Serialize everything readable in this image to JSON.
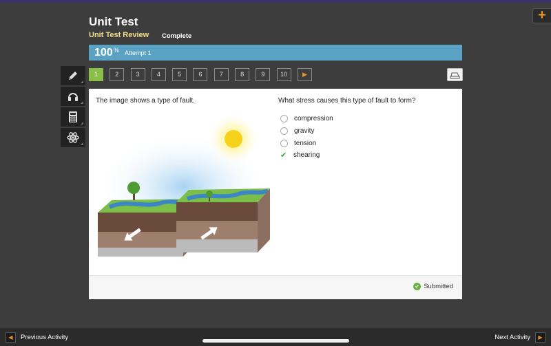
{
  "header": {
    "title": "Unit Test",
    "subtitle": "Unit Test Review",
    "status": "Complete",
    "plus_icon": "+"
  },
  "score": {
    "value": "100",
    "percent_symbol": "%",
    "attempt": "Attempt 1"
  },
  "tools": [
    {
      "icon": "pencil-icon"
    },
    {
      "icon": "headphones-icon"
    },
    {
      "icon": "calculator-icon"
    },
    {
      "icon": "atom-icon"
    }
  ],
  "question_nav": {
    "items": [
      "1",
      "2",
      "3",
      "4",
      "5",
      "6",
      "7",
      "8",
      "9",
      "10"
    ],
    "active": "1",
    "next_icon": "▶"
  },
  "card": {
    "prompt": "The image shows a type of fault.",
    "question": "What stress causes this type of fault to form?",
    "options": [
      {
        "label": "compression",
        "selected": false
      },
      {
        "label": "gravity",
        "selected": false
      },
      {
        "label": "tension",
        "selected": false
      },
      {
        "label": "shearing",
        "selected": true
      }
    ],
    "check_icon": "✔",
    "submitted_label": "Submitted",
    "submitted_icon": "✔"
  },
  "bottom": {
    "prev_label": "Previous Activity",
    "next_label": "Next Activity",
    "prev_icon": "◀",
    "next_icon": "▶"
  },
  "colors": {
    "accent_orange": "#e8952c",
    "score_bar": "#5aa2c4",
    "active_green": "#8cbf4a",
    "subtitle_yellow": "#f2e08a"
  }
}
